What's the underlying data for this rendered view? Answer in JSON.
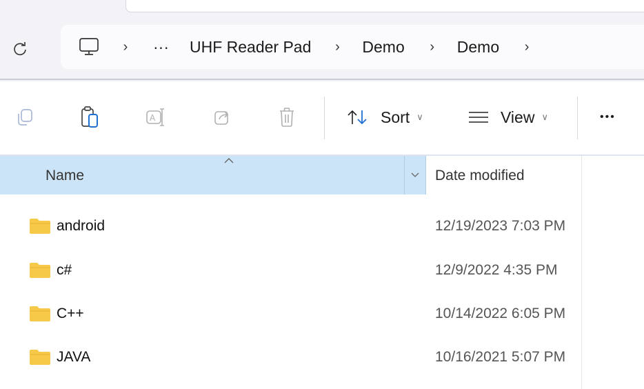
{
  "breadcrumb": {
    "overflow": "···",
    "items": [
      "UHF Reader Pad",
      "Demo",
      "Demo"
    ]
  },
  "toolbar": {
    "sort_label": "Sort",
    "view_label": "View",
    "more": "•••"
  },
  "columns": {
    "name": "Name",
    "date_modified": "Date modified"
  },
  "files": [
    {
      "name": "android",
      "date": "12/19/2023 7:03 PM"
    },
    {
      "name": "c#",
      "date": "12/9/2022 4:35 PM"
    },
    {
      "name": "C++",
      "date": "10/14/2022 6:05 PM"
    },
    {
      "name": "JAVA",
      "date": "10/16/2021 5:07 PM"
    }
  ],
  "colors": {
    "header_selected": "#cce4f7",
    "folder_yellow": "#f7c948"
  }
}
